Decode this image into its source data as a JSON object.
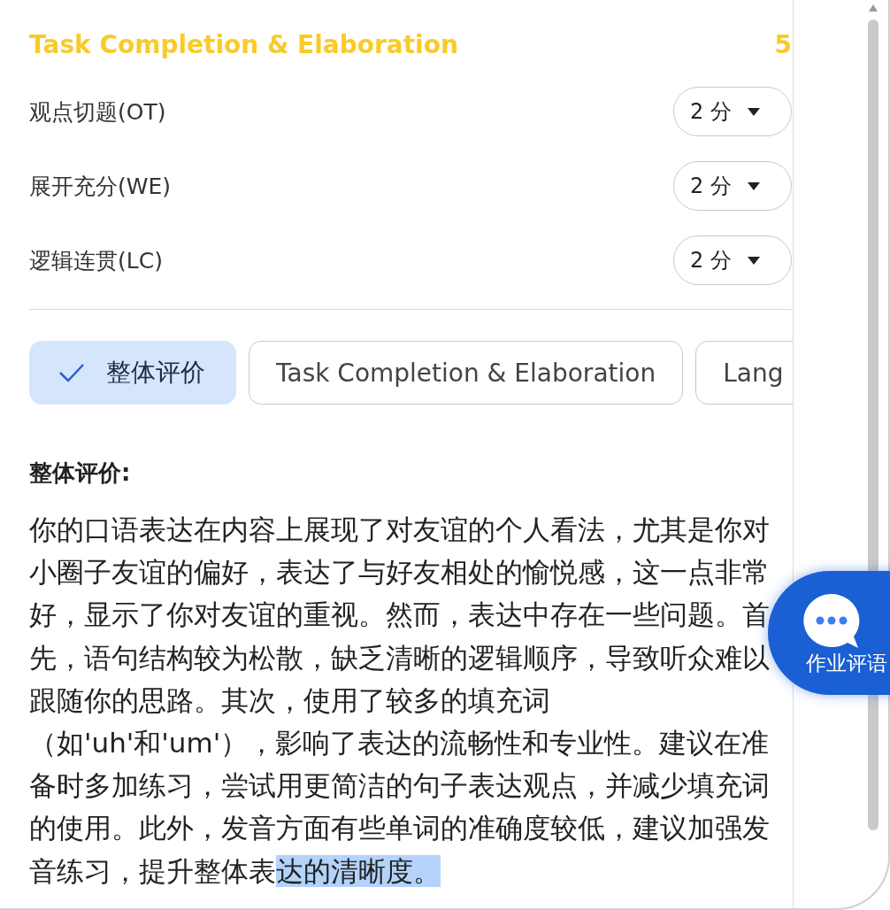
{
  "section": {
    "title": "Task Completion & Elaboration",
    "score": "5"
  },
  "criteria": [
    {
      "label": "观点切题(OT)",
      "value": "2 分"
    },
    {
      "label": "展开充分(WE)",
      "value": "2 分"
    },
    {
      "label": "逻辑连贯(LC)",
      "value": "2 分"
    }
  ],
  "tabs": [
    {
      "label": "整体评价",
      "selected": true
    },
    {
      "label": "Task Completion & Elaboration",
      "selected": false
    },
    {
      "label": "Lang",
      "selected": false
    }
  ],
  "comment": {
    "heading": "整体评价:",
    "parts": [
      {
        "text": "你的口语表达在内容上展现了对友谊的个人看法，尤其是你对小圈子友谊的偏好，表达了与好友相处的愉悦感，这一点非常好，显示了你对友谊的重视。然而，表达中存在一些问题。首先，语句结构较为松散，缺乏清晰的逻辑顺序，导致听众难以跟随你的思路。其次，使用了较多的填充词（如'uh'和'um'），影响了表达的流畅性和专业性。建议在准备时多加练习，尝试用更简洁的句子表达观点，并减少填充词的使用。此外，发音方面有些单词的准确度较低，建议加强发音练习，提升整体表",
        "selected": false
      },
      {
        "text": "达的清晰度。",
        "selected": true
      }
    ]
  },
  "float_button": {
    "label": "作业评语"
  }
}
